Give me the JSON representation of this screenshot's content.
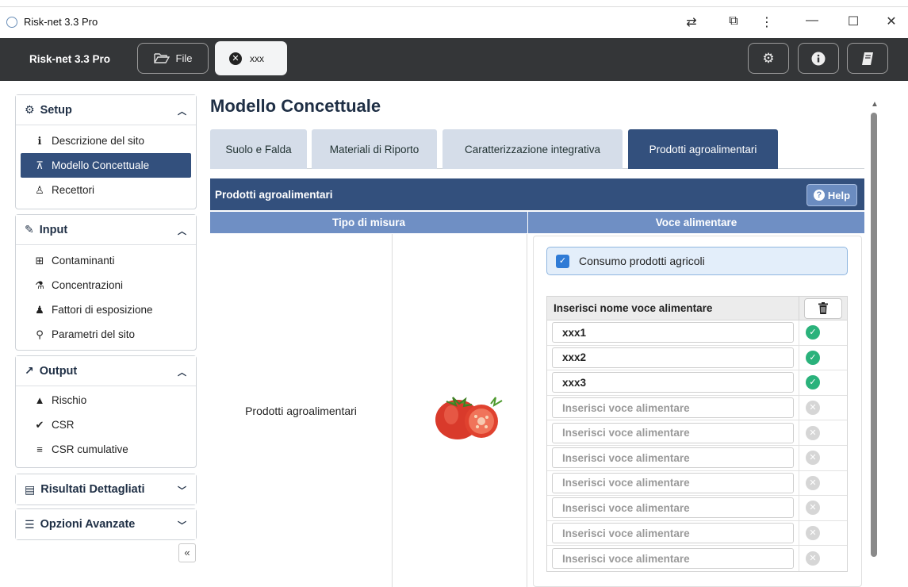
{
  "window": {
    "title": "Risk-net 3.3 Pro",
    "controls": {
      "minimize": "—",
      "maximize": "☐",
      "close": "✕"
    }
  },
  "toolbar": {
    "brand": "Risk-net 3.3 Pro",
    "file_label": "File",
    "open_tab_label": "xxx",
    "right_buttons": [
      "gear-icon",
      "info-icon",
      "book-icon"
    ]
  },
  "sidebar": {
    "setup": {
      "title": "Setup",
      "items": [
        {
          "label": "Descrizione del sito",
          "icon": "info-circle-icon",
          "active": false
        },
        {
          "label": "Modello Concettuale",
          "icon": "sitemap-icon",
          "active": true
        },
        {
          "label": "Recettori",
          "icon": "person-icon",
          "active": false
        }
      ]
    },
    "input": {
      "title": "Input",
      "items": [
        {
          "label": "Contaminanti",
          "icon": "plus-square-icon"
        },
        {
          "label": "Concentrazioni",
          "icon": "flask-icon"
        },
        {
          "label": "Fattori di esposizione",
          "icon": "user-icon"
        },
        {
          "label": "Parametri del sito",
          "icon": "map-pin-icon"
        }
      ]
    },
    "output": {
      "title": "Output",
      "items": [
        {
          "label": "Rischio",
          "icon": "warning-icon"
        },
        {
          "label": "CSR",
          "icon": "check-circle-icon"
        },
        {
          "label": "CSR cumulative",
          "icon": "list-icon"
        }
      ]
    },
    "risultati": {
      "title": "Risultati Dettagliati"
    },
    "opzioni": {
      "title": "Opzioni Avanzate"
    },
    "collapse_label": "«"
  },
  "main": {
    "page_title": "Modello Concettuale",
    "tabs": [
      {
        "label": "Suolo e Falda",
        "active": false
      },
      {
        "label": "Materiali di Riporto",
        "active": false
      },
      {
        "label": "Caratterizzazione integrativa",
        "active": false
      },
      {
        "label": "Prodotti agroalimentari",
        "active": true
      }
    ],
    "section_title": "Prodotti agroalimentari",
    "help_label": "Help",
    "col_tipo": "Tipo di misura",
    "col_voce": "Voce alimentare",
    "row_label": "Prodotti agroalimentari",
    "checkbox_label": "Consumo prodotti agricoli",
    "checkbox_checked": true,
    "table_header": "Inserisci nome voce alimentare",
    "placeholder": "Inserisci voce alimentare",
    "entries": [
      "xxx1",
      "xxx2",
      "xxx3",
      "",
      "",
      "",
      "",
      "",
      "",
      ""
    ]
  },
  "colors": {
    "primary": "#33507d",
    "column_header": "#6f8fc4",
    "tab_inactive": "#d5dde9",
    "toolbar_bg": "#343638",
    "status_ok": "#2ab27b",
    "status_empty": "#d6d6d6"
  }
}
